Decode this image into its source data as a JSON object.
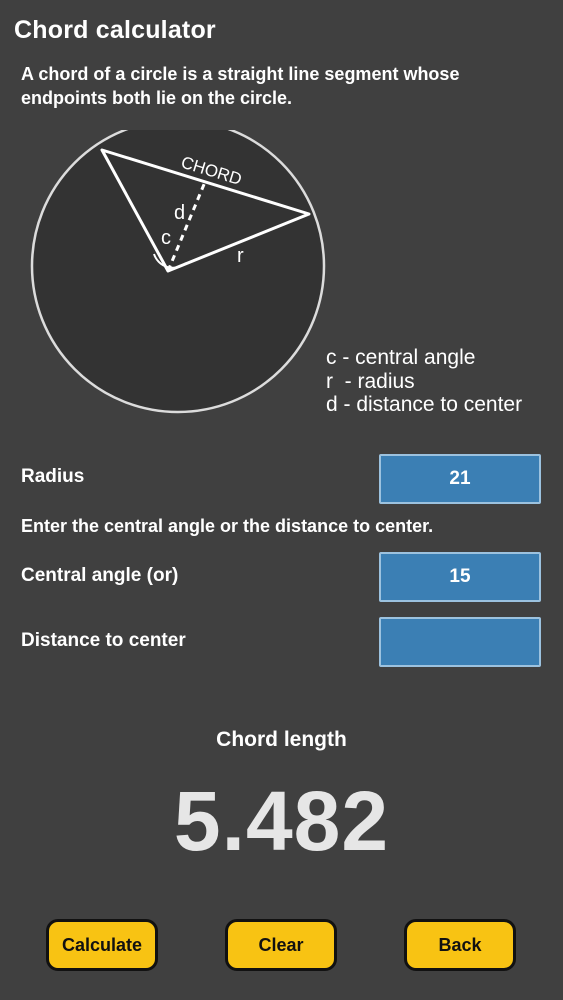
{
  "header": {
    "title": "Chord calculator",
    "description": "A chord of a circle is a straight line segment whose endpoints both lie on the circle."
  },
  "diagram": {
    "chord_label": "CHORD",
    "d_label": "d",
    "c_label": "c",
    "r_label": "r"
  },
  "legend": {
    "items": [
      "c - central angle",
      "r  - radius",
      "d - distance to center"
    ]
  },
  "form": {
    "radius_label": "Radius",
    "radius_value": "21",
    "instruction": "Enter the central angle or the distance to center.",
    "angle_label": "Central angle (or)",
    "angle_value": "15",
    "distance_label": "Distance to center",
    "distance_value": ""
  },
  "result": {
    "label": "Chord length",
    "value": "5.482"
  },
  "buttons": {
    "calculate": "Calculate",
    "clear": "Clear",
    "back": "Back"
  },
  "colors": {
    "background": "#404040",
    "field_fill": "#3b7fb4",
    "button_fill": "#f8c313"
  }
}
